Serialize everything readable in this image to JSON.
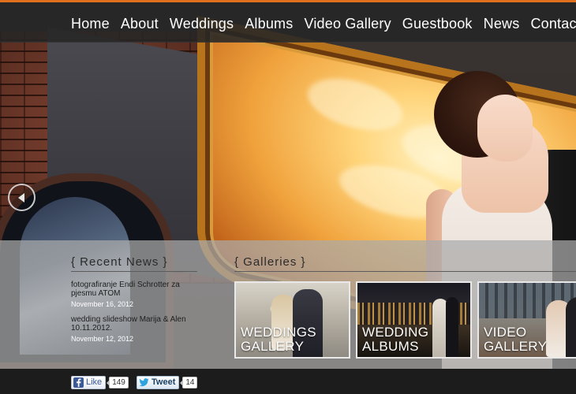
{
  "nav": {
    "items": [
      {
        "label": "Home"
      },
      {
        "label": "About"
      },
      {
        "label": "Weddings"
      },
      {
        "label": "Albums"
      },
      {
        "label": "Video Gallery"
      },
      {
        "label": "Guestbook"
      },
      {
        "label": "News"
      },
      {
        "label": "Contac"
      }
    ]
  },
  "slider": {
    "prev_icon": "chevron-left-icon"
  },
  "recent_news": {
    "title": "{ Recent News }",
    "items": [
      {
        "title": "fotografiranje Endi Schrotter za pjesmu ATOM",
        "date": "November 16, 2012"
      },
      {
        "title": "wedding slideshow Marija & Alen 10.11.2012.",
        "date": "November 12, 2012"
      }
    ]
  },
  "galleries": {
    "title": "{ Galleries }",
    "cards": [
      {
        "line1": "WEDDINGS",
        "line2": "GALLERY"
      },
      {
        "line1": "WEDDING",
        "line2": "ALBUMS"
      },
      {
        "line1": "VIDEO",
        "line2": "GALLERY"
      }
    ]
  },
  "social": {
    "like_label": "Like",
    "like_count": "149",
    "tweet_label": "Tweet",
    "tweet_count": "14"
  },
  "colors": {
    "accent": "#e0701e",
    "facebook": "#3b5998",
    "twitter": "#2fa3e0"
  }
}
